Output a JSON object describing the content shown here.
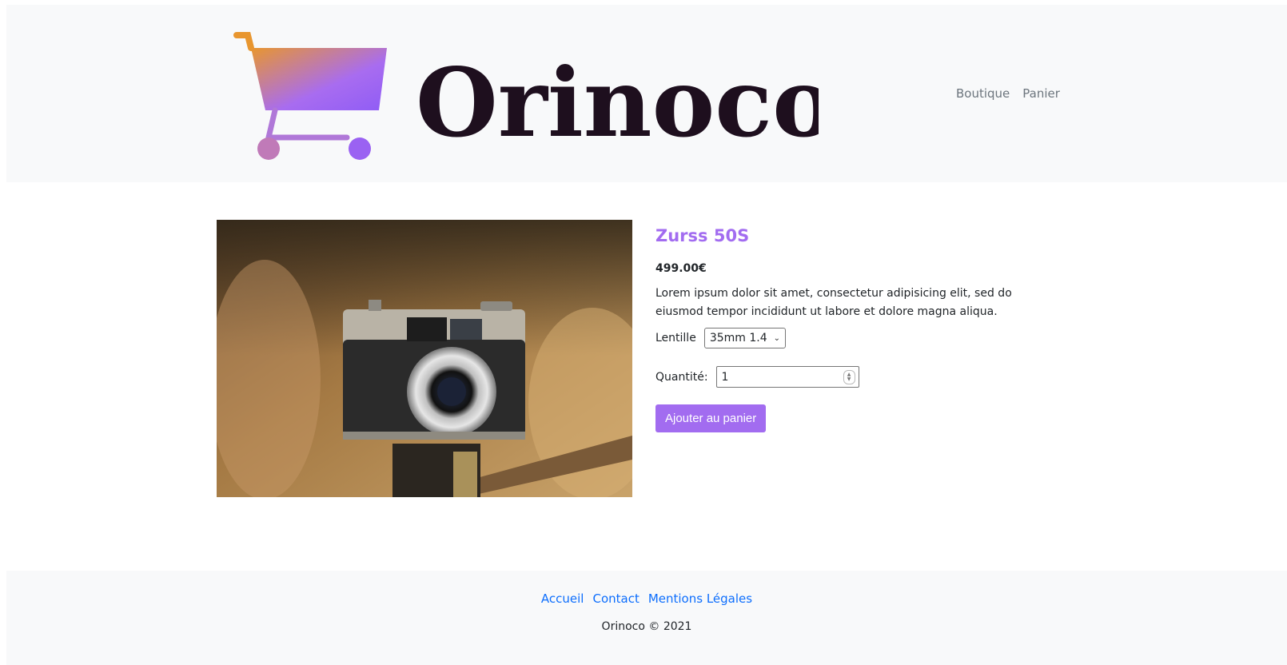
{
  "header": {
    "brand": "Orinoco",
    "nav": [
      "Boutique",
      "Panier"
    ]
  },
  "product": {
    "name": "Zurss 50S",
    "price": "499.00€",
    "description": "Lorem ipsum dolor sit amet, consectetur adipisicing elit, sed do eiusmod tempor incididunt ut labore et dolore magna aliqua.",
    "lens_label": "Lentille",
    "lens_selected": "35mm 1.4",
    "quantity_label": "Quantité:",
    "quantity_value": "1",
    "add_button": "Ajouter au panier"
  },
  "footer": {
    "links": [
      "Accueil",
      "Contact",
      "Mentions Légales"
    ],
    "copyright": "Orinoco © 2021"
  },
  "colors": {
    "accent": "#a26cf0",
    "header_bg": "#f8f9fa",
    "link": "#0d6efd"
  },
  "icons": [
    "cart-logo-icon",
    "chevron-down-icon",
    "spinner-icon"
  ]
}
